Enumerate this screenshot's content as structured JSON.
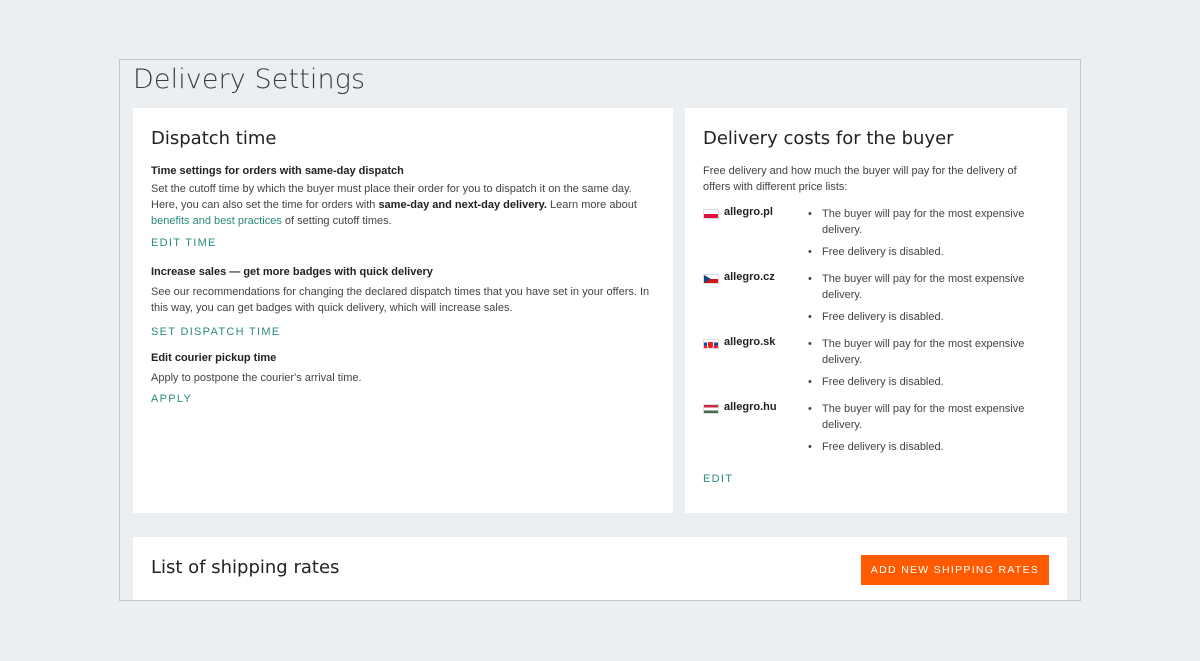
{
  "page": {
    "title": "Delivery Settings"
  },
  "dispatch": {
    "title": "Dispatch time",
    "same_day": {
      "title": "Time settings for orders with same-day dispatch",
      "text_1": "Set the cutoff time by which the buyer must place their order for you to dispatch it on the same day. Here, you can also set the time for orders with ",
      "text_bold": "same-day and next-day delivery.",
      "text_2": " Learn more about ",
      "link": "benefits and best practices",
      "text_3": " of setting cutoff times.",
      "action": "EDIT TIME"
    },
    "badges": {
      "title": "Increase sales — get more badges with quick delivery",
      "text": "See our recommendations for changing the declared dispatch times that you have set in your offers. In this way, you can get badges with quick delivery, which will increase sales.",
      "action": "SET DISPATCH TIME"
    },
    "pickup": {
      "title": "Edit courier pickup time",
      "text": "Apply to postpone the courier's arrival time.",
      "action": "APPLY"
    }
  },
  "costs": {
    "title": "Delivery costs for the buyer",
    "intro": "Free delivery and how much the buyer will pay for the delivery of offers with different price lists:",
    "markets": [
      {
        "name": "allegro.pl",
        "flag": "flag-pl-icon",
        "line_1": "The buyer will pay for the most expensive delivery.",
        "line_2": "Free delivery is disabled."
      },
      {
        "name": "allegro.cz",
        "flag": "flag-cz-icon",
        "line_1": "The buyer will pay for the most expensive delivery.",
        "line_2": "Free delivery is disabled."
      },
      {
        "name": "allegro.sk",
        "flag": "flag-sk-icon",
        "line_1": "The buyer will pay for the most expensive delivery.",
        "line_2": "Free delivery is disabled."
      },
      {
        "name": "allegro.hu",
        "flag": "flag-hu-icon",
        "line_1": "The buyer will pay for the most expensive delivery.",
        "line_2": "Free delivery is disabled."
      }
    ],
    "action": "EDIT"
  },
  "rates": {
    "title": "List of shipping rates",
    "add_button": "ADD NEW SHIPPING RATES"
  },
  "colors": {
    "accent": "#2a8a7e",
    "cta": "#ff5a00",
    "background": "#eceff2"
  }
}
